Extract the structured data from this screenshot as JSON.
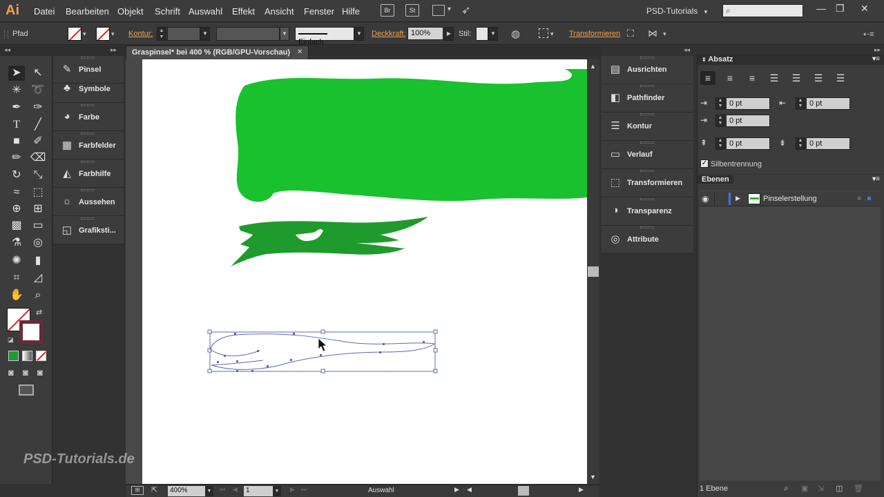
{
  "app": {
    "logo": "Ai"
  },
  "menu": [
    "Datei",
    "Bearbeiten",
    "Objekt",
    "Schrift",
    "Auswahl",
    "Effekt",
    "Ansicht",
    "Fenster",
    "Hilfe"
  ],
  "toolbar_icons": {
    "bridge": "Br",
    "stock": "St"
  },
  "workspace": {
    "label": "PSD-Tutorials",
    "arrow": "▾"
  },
  "search": {
    "placeholder": ""
  },
  "window_controls": [
    "—",
    "❐",
    "✕"
  ],
  "controlbar": {
    "object_type": "Pfad",
    "kontur_label": "Kontur:",
    "stroke_style": "Einfach",
    "deckkraft_label": "Deckkraft:",
    "deckkraft_value": "100%",
    "stil_label": "Stil:",
    "transform_label": "Transformieren"
  },
  "document": {
    "tab_title": "Graspinsel* bei 400 % (RGB/GPU-Vorschau)",
    "close": "✕"
  },
  "statusbar": {
    "zoom": "400%",
    "page": "1",
    "tool": "Auswahl"
  },
  "left_dock": [
    {
      "label": "Pinsel",
      "icon": "brush-icon",
      "glyph": "✎"
    },
    {
      "label": "Symbole",
      "icon": "club-icon",
      "glyph": "♣"
    },
    {
      "label": "Farbe",
      "icon": "palette-icon",
      "glyph": "◕"
    },
    {
      "label": "Farbfelder",
      "icon": "grid-icon",
      "glyph": "▦"
    },
    {
      "label": "Farbhilfe",
      "icon": "color-guide-icon",
      "glyph": "◭"
    },
    {
      "label": "Aussehen",
      "icon": "sun-icon",
      "glyph": "☼"
    },
    {
      "label": "Grafiksti...",
      "icon": "graphic-styles-icon",
      "glyph": "◱"
    }
  ],
  "right_dock": [
    {
      "label": "Ausrichten",
      "icon": "align-icon",
      "glyph": "▤"
    },
    {
      "label": "Pathfinder",
      "icon": "pathfinder-icon",
      "glyph": "◧"
    },
    {
      "label": "Kontur",
      "icon": "stroke-icon",
      "glyph": "☰"
    },
    {
      "label": "Verlauf",
      "icon": "gradient-icon",
      "glyph": "▭"
    },
    {
      "label": "Transformieren",
      "icon": "transform-icon",
      "glyph": "⬚"
    },
    {
      "label": "Transparenz",
      "icon": "transparency-icon",
      "glyph": "◑"
    },
    {
      "label": "Attribute",
      "icon": "attributes-icon",
      "glyph": "◎"
    }
  ],
  "absatz": {
    "title": "Absatz",
    "left_indent": "0 pt",
    "right_indent": "0 pt",
    "first_line_indent": "0 pt",
    "space_before": "0 pt",
    "space_after": "0 pt",
    "hyphenation_label": "Silbentrennung",
    "hyphenation_checked": true
  },
  "ebenen": {
    "title": "Ebenen",
    "layer_name": "Pinselerstellung",
    "layer_color": "#4a6fe0",
    "footer": "1 Ebene"
  },
  "colors": {
    "green_light": "#19c12f",
    "green_dark": "#1f9a2c",
    "selection": "#5a6ab0"
  },
  "watermark": "PSD-Tutorials.de"
}
